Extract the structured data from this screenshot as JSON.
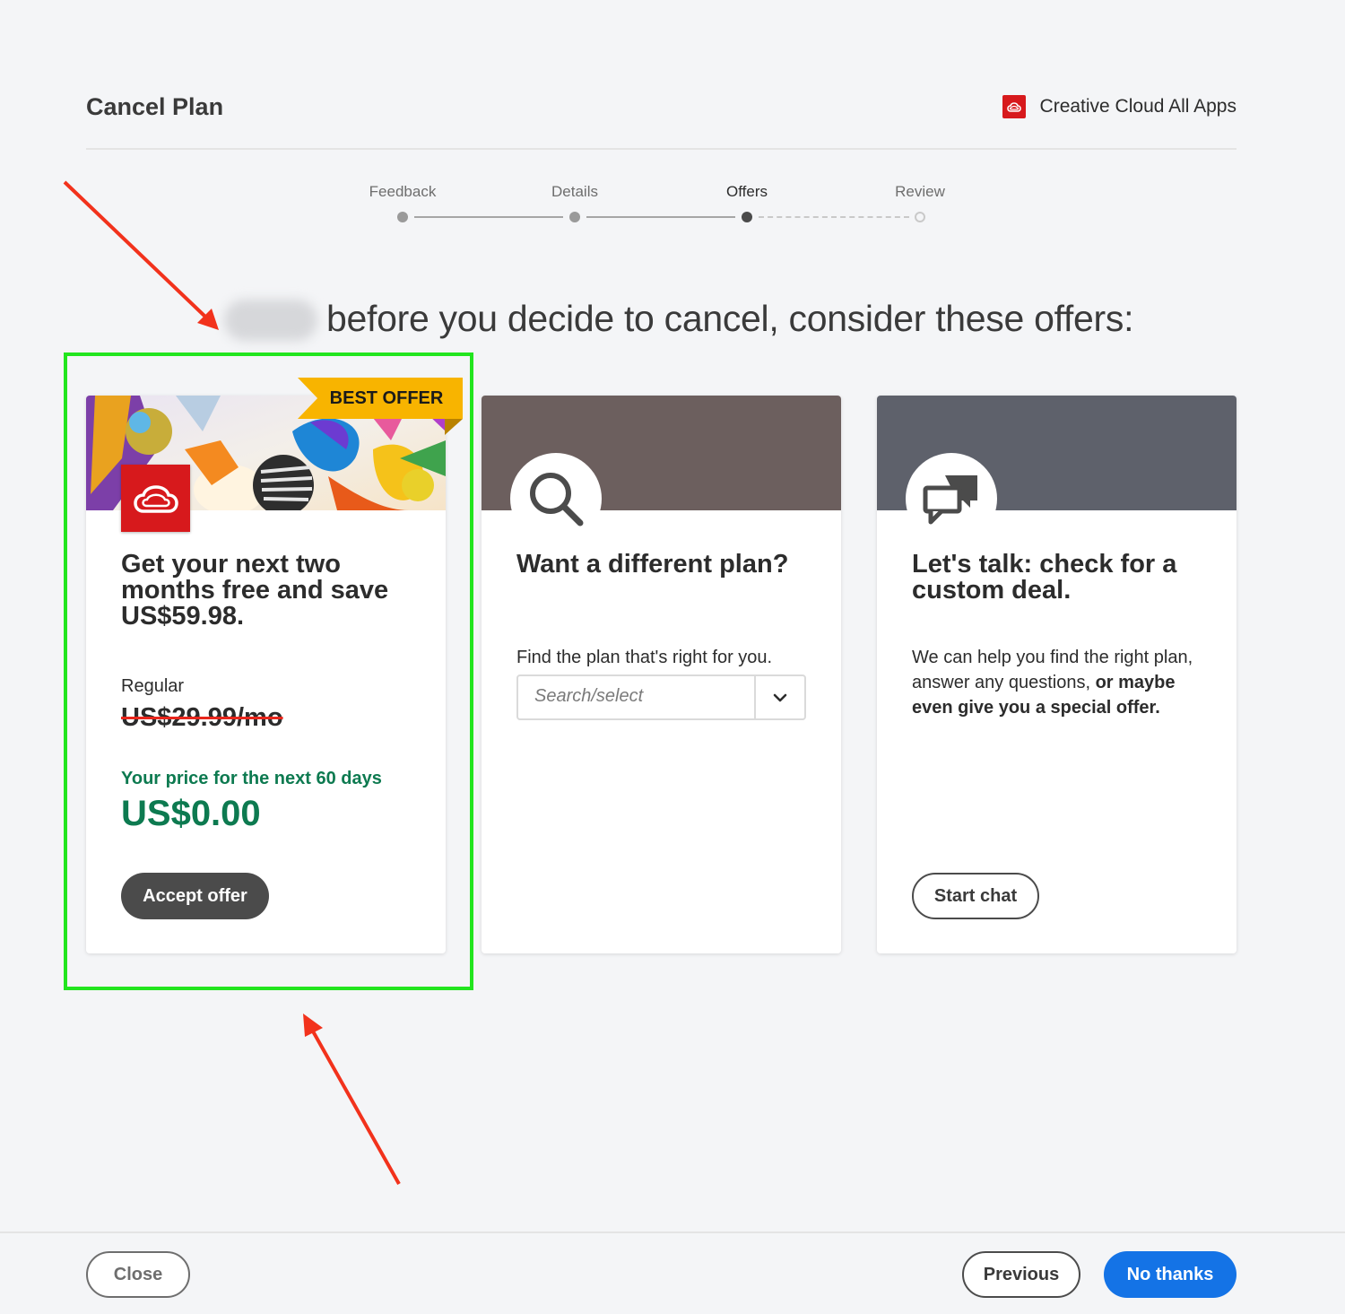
{
  "header": {
    "title": "Cancel Plan",
    "product_name": "Creative Cloud All Apps"
  },
  "stepper": {
    "steps": [
      {
        "label": "Feedback",
        "state": "done"
      },
      {
        "label": "Details",
        "state": "done"
      },
      {
        "label": "Offers",
        "state": "current"
      },
      {
        "label": "Review",
        "state": "upcoming"
      }
    ]
  },
  "headline": "before you decide to cancel, consider these offers:",
  "cards": {
    "offer": {
      "badge": "BEST OFFER",
      "title": "Get your next two months free and save US$59.98.",
      "regular_label": "Regular",
      "regular_price": "US$29.99/mo",
      "promo_label": "Your price for the next 60 days",
      "promo_price": "US$0.00",
      "button": "Accept offer"
    },
    "plan": {
      "title": "Want a different plan?",
      "text": "Find the plan that's right for you.",
      "select_placeholder": "Search/select"
    },
    "chat": {
      "title": "Let's talk: check for a custom deal.",
      "text_regular": "We can help you find the right plan, answer any questions, ",
      "text_bold": "or maybe even give you a special offer.",
      "button": "Start chat"
    }
  },
  "footer": {
    "close": "Close",
    "previous": "Previous",
    "no_thanks": "No thanks"
  },
  "colors": {
    "accent_blue": "#1473e6",
    "adobe_red": "#d7191c",
    "promo_green": "#0d7a50",
    "badge_yellow": "#f8b400",
    "highlight_green": "#22e51e",
    "arrow_red": "#f2321c"
  }
}
